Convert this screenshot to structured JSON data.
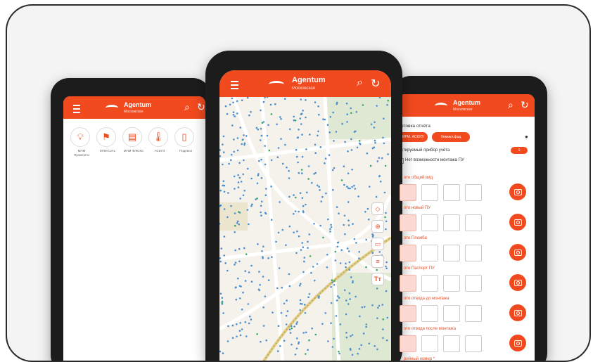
{
  "app": {
    "name": "Agentum",
    "region": "Московская"
  },
  "left_screen": {
    "tiles": [
      {
        "icon": "bulb-icon",
        "label": "МПМ ПромСити"
      },
      {
        "icon": "flag-icon",
        "label": "МПМ Сеть"
      },
      {
        "icon": "meter-icon",
        "label": "МПМ ФЛЮКС"
      },
      {
        "icon": "thermometer-icon",
        "label": "АСКУЭ"
      },
      {
        "icon": "document-icon",
        "label": "Подписи"
      }
    ]
  },
  "right_screen": {
    "section_title": "отовка отчёта",
    "chips": [
      "ИРМ. АСКУЭ",
      "Химикл.фад"
    ],
    "device_label": "стируемый прибор учёта",
    "counter": "1",
    "checkbox_label": "Нет возможности монтажа ПУ",
    "fields": [
      "ото общий вид",
      "ото новый ПУ",
      "ото Пломба",
      "ото Паспорт ПУ",
      "ото отвода до монтажа",
      "ото отвода после монтажа"
    ],
    "last_label": "рийный номер *"
  }
}
